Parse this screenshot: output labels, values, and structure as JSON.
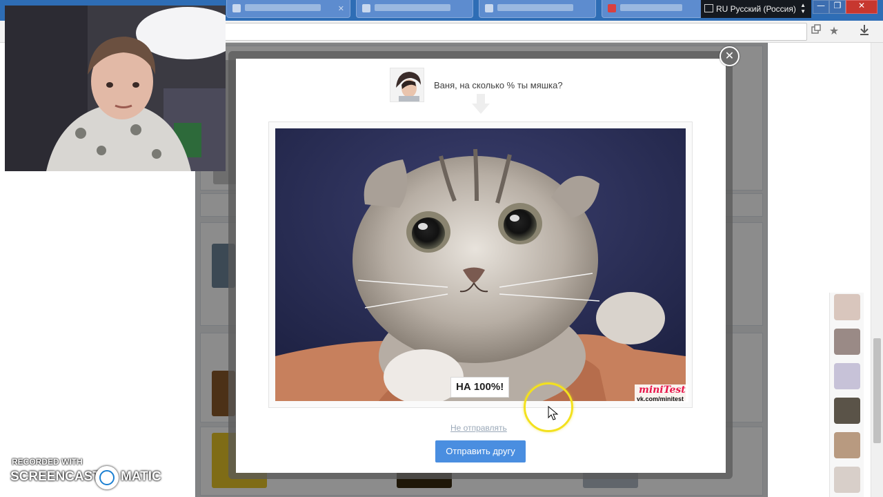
{
  "browser": {
    "language_indicator": "RU Русский (Россия)",
    "window_controls": {
      "minimize": "—",
      "restore": "❐",
      "close": "✕"
    },
    "address_bar_icons": [
      "bookmark-manager-icon",
      "star-icon",
      "download-icon"
    ]
  },
  "dialog": {
    "question": "Ваня, на сколько % ты мяшка?",
    "result_label": "НА 100%!",
    "brand_logo": "miniTest",
    "brand_url": "vk.com/minitest",
    "skip_link": "Не отправлять",
    "send_button": "Отправить другу",
    "close_symbol": "✕"
  },
  "watermark": {
    "recorded_with": "RECORDED WITH",
    "brand_left": "SCREENCAST",
    "brand_right": "MATIC"
  },
  "colors": {
    "chrome_blue": "#2e6db5",
    "send_button": "#4a8ee0",
    "skip_link": "#9aa8b8",
    "cursor_highlight": "#f3e11e",
    "brand_pink": "#e8174b"
  }
}
